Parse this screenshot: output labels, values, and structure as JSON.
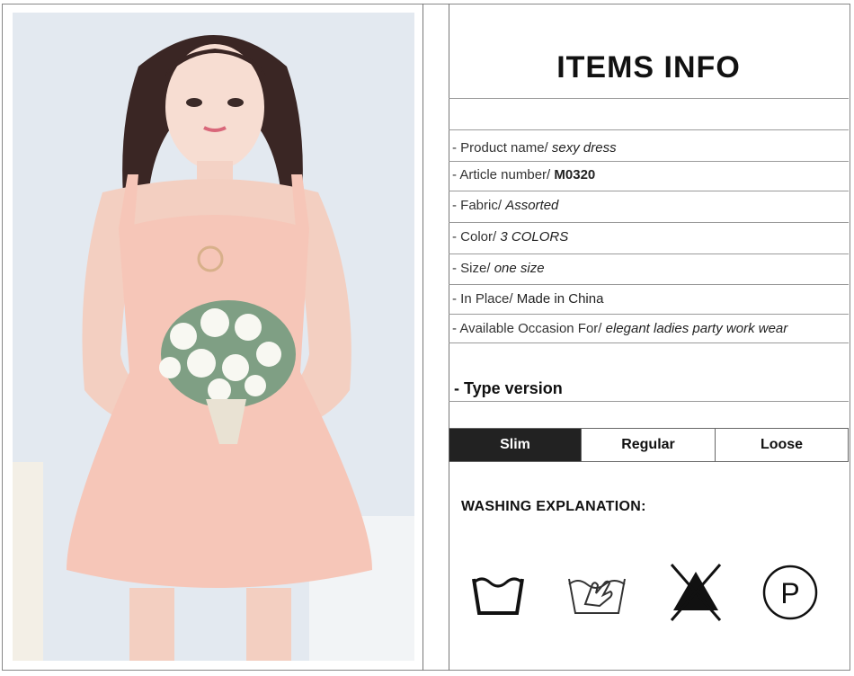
{
  "page": {
    "title": "ITEMS INFO",
    "rows": [
      {
        "label": "- Product name/",
        "value": "sexy dress"
      },
      {
        "label": "- Article number/",
        "value": "M0320"
      },
      {
        "label": "- Fabric/",
        "value": "Assorted"
      },
      {
        "label": "- Color/",
        "value": "3 COLORS"
      },
      {
        "label": "- Size/",
        "value": "one size"
      },
      {
        "label": "- In Place/",
        "value": "Made in China"
      },
      {
        "label": "- Available Occasion For/",
        "value": "elegant ladies party work wear"
      }
    ],
    "type_version": "- Type version",
    "fit_options": [
      {
        "label": "Slim",
        "selected": true
      },
      {
        "label": "Regular",
        "selected": false
      },
      {
        "label": "Loose",
        "selected": false
      }
    ],
    "washing_title": "WASHING EXPLANATION:",
    "care_icons": [
      {
        "name": "machine-wash-icon"
      },
      {
        "name": "hand-wash-icon"
      },
      {
        "name": "do-not-bleach-icon"
      },
      {
        "name": "dry-clean-p-icon",
        "letter": "P"
      }
    ]
  }
}
